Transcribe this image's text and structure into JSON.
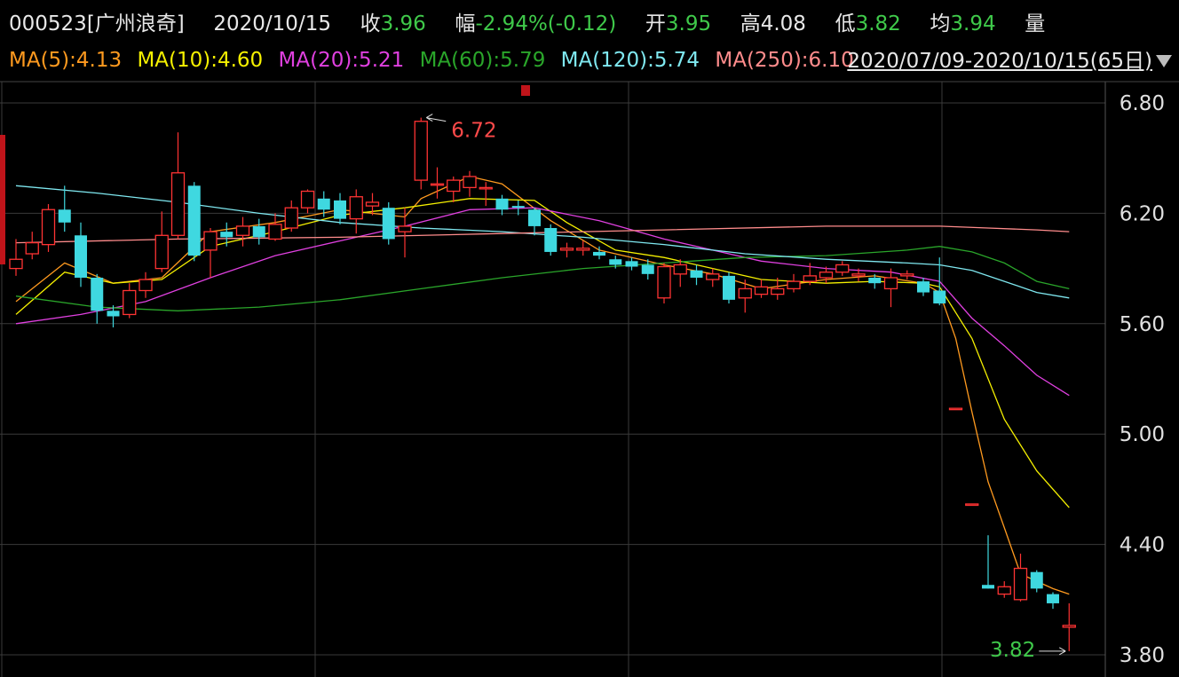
{
  "header": {
    "code": "000523",
    "name": "[广州浪奇]",
    "date": "2020/10/15",
    "close_label": "收",
    "close_value": "3.96",
    "change_label": "幅",
    "change_value": "-2.94%(-0.12)",
    "open_label": "开",
    "open_value": "3.95",
    "high_label": "高",
    "high_value": "4.08",
    "low_label": "低",
    "low_value": "3.82",
    "avg_label": "均",
    "avg_value": "3.94",
    "volume_label": "量"
  },
  "ma_legend": [
    {
      "label": "MA(5):4.13",
      "color": "#ff9a1f"
    },
    {
      "label": "MA(10):4.60",
      "color": "#f5f000"
    },
    {
      "label": "MA(20):5.21",
      "color": "#e040e0"
    },
    {
      "label": "MA(60):5.79",
      "color": "#2aa52a"
    },
    {
      "label": "MA(120):5.74",
      "color": "#7fe8f0"
    },
    {
      "label": "MA(250):6.10",
      "color": "#ff8c8c"
    }
  ],
  "range_label": "2020/07/09-2020/10/15(65日)",
  "dropdown_icon": "triangle-down-icon",
  "chart_data": {
    "type": "candlestick",
    "ylim": [
      3.8,
      6.8
    ],
    "yticks": [
      "6.80",
      "6.20",
      "5.60",
      "5.00",
      "4.40",
      "3.80"
    ],
    "annotations": [
      {
        "label": "6.72",
        "value": 6.72,
        "color": "#ff4a4a"
      },
      {
        "label": "3.82",
        "value": 3.82,
        "color": "#3fc94a"
      }
    ],
    "colors": {
      "up": "#ff3333",
      "down": "#3fd8e0",
      "grid": "#3a3a3a",
      "axis_text": "#e0e0e0"
    },
    "candles": [
      [
        5.9,
        5.95,
        6.06,
        5.86
      ],
      [
        5.98,
        6.04,
        6.1,
        5.95
      ],
      [
        6.03,
        6.22,
        6.25,
        5.99
      ],
      [
        6.22,
        6.15,
        6.35,
        6.1
      ],
      [
        6.08,
        5.85,
        6.15,
        5.8
      ],
      [
        5.85,
        5.67,
        5.87,
        5.6
      ],
      [
        5.67,
        5.64,
        5.7,
        5.58
      ],
      [
        5.65,
        5.78,
        5.82,
        5.63
      ],
      [
        5.78,
        5.84,
        5.88,
        5.74
      ],
      [
        5.9,
        6.08,
        6.21,
        5.88
      ],
      [
        6.08,
        6.42,
        6.64,
        6.06
      ],
      [
        6.35,
        5.97,
        6.37,
        5.94
      ],
      [
        6.0,
        6.1,
        6.12,
        5.85
      ],
      [
        6.1,
        6.07,
        6.15,
        6.02
      ],
      [
        6.08,
        6.13,
        6.18,
        6.02
      ],
      [
        6.13,
        6.07,
        6.17,
        6.03
      ],
      [
        6.06,
        6.14,
        6.2,
        6.05
      ],
      [
        6.12,
        6.23,
        6.27,
        6.1
      ],
      [
        6.23,
        6.32,
        6.33,
        6.2
      ],
      [
        6.28,
        6.22,
        6.32,
        6.18
      ],
      [
        6.27,
        6.17,
        6.31,
        6.14
      ],
      [
        6.17,
        6.29,
        6.33,
        6.09
      ],
      [
        6.24,
        6.26,
        6.31,
        6.19
      ],
      [
        6.23,
        6.06,
        6.26,
        6.03
      ],
      [
        6.1,
        6.13,
        6.23,
        5.96
      ],
      [
        6.38,
        6.7,
        6.72,
        6.33
      ],
      [
        6.36,
        6.36,
        6.45,
        6.28
      ],
      [
        6.32,
        6.38,
        6.4,
        6.26
      ],
      [
        6.34,
        6.4,
        6.43,
        6.29
      ],
      [
        6.34,
        6.34,
        6.37,
        6.24
      ],
      [
        6.28,
        6.22,
        6.3,
        6.19
      ],
      [
        6.24,
        6.23,
        6.27,
        6.19
      ],
      [
        6.22,
        6.13,
        6.23,
        6.08
      ],
      [
        6.12,
        5.99,
        6.14,
        5.97
      ],
      [
        6.0,
        6.01,
        6.04,
        5.96
      ],
      [
        6.0,
        6.01,
        6.05,
        5.97
      ],
      [
        5.99,
        5.97,
        6.02,
        5.95
      ],
      [
        5.95,
        5.92,
        5.97,
        5.9
      ],
      [
        5.94,
        5.91,
        5.96,
        5.89
      ],
      [
        5.92,
        5.87,
        5.95,
        5.84
      ],
      [
        5.74,
        5.91,
        5.93,
        5.71
      ],
      [
        5.87,
        5.92,
        5.95,
        5.8
      ],
      [
        5.89,
        5.85,
        5.92,
        5.81
      ],
      [
        5.84,
        5.87,
        5.9,
        5.8
      ],
      [
        5.86,
        5.73,
        5.88,
        5.71
      ],
      [
        5.74,
        5.79,
        5.84,
        5.66
      ],
      [
        5.76,
        5.8,
        5.84,
        5.74
      ],
      [
        5.76,
        5.79,
        5.85,
        5.73
      ],
      [
        5.79,
        5.83,
        5.87,
        5.77
      ],
      [
        5.83,
        5.86,
        5.93,
        5.81
      ],
      [
        5.85,
        5.88,
        5.91,
        5.82
      ],
      [
        5.88,
        5.92,
        5.94,
        5.86
      ],
      [
        5.86,
        5.87,
        5.9,
        5.83
      ],
      [
        5.85,
        5.82,
        5.87,
        5.79
      ],
      [
        5.79,
        5.85,
        5.9,
        5.69
      ],
      [
        5.86,
        5.87,
        5.89,
        5.84
      ],
      [
        5.83,
        5.77,
        5.85,
        5.75
      ],
      [
        5.78,
        5.71,
        5.96,
        5.7
      ],
      [
        5.14,
        5.14,
        5.14,
        5.14
      ],
      [
        4.62,
        4.62,
        4.62,
        4.62
      ],
      [
        4.18,
        4.16,
        4.45,
        4.16
      ],
      [
        4.13,
        4.17,
        4.2,
        4.11
      ],
      [
        4.1,
        4.27,
        4.35,
        4.09
      ],
      [
        4.25,
        4.16,
        4.26,
        4.14
      ],
      [
        4.13,
        4.08,
        4.14,
        4.05
      ],
      [
        3.95,
        3.96,
        4.08,
        3.82
      ]
    ],
    "series": [
      {
        "name": "MA(5)",
        "color": "#ff9a1f",
        "points": [
          [
            0,
            5.72
          ],
          [
            3,
            5.93
          ],
          [
            6,
            5.82
          ],
          [
            9,
            5.85
          ],
          [
            12,
            6.1
          ],
          [
            16,
            6.15
          ],
          [
            20,
            6.22
          ],
          [
            24,
            6.18
          ],
          [
            25,
            6.28
          ],
          [
            28,
            6.4
          ],
          [
            30,
            6.36
          ],
          [
            33,
            6.16
          ],
          [
            36,
            6.0
          ],
          [
            40,
            5.92
          ],
          [
            43,
            5.87
          ],
          [
            46,
            5.79
          ],
          [
            50,
            5.84
          ],
          [
            53,
            5.86
          ],
          [
            56,
            5.82
          ],
          [
            57,
            5.77
          ],
          [
            58,
            5.52
          ],
          [
            59,
            5.12
          ],
          [
            60,
            4.74
          ],
          [
            61,
            4.49
          ],
          [
            62,
            4.24
          ],
          [
            63,
            4.2
          ],
          [
            64,
            4.16
          ],
          [
            65,
            4.13
          ]
        ]
      },
      {
        "name": "MA(10)",
        "color": "#f5f000",
        "points": [
          [
            0,
            5.65
          ],
          [
            3,
            5.88
          ],
          [
            6,
            5.82
          ],
          [
            9,
            5.84
          ],
          [
            12,
            6.02
          ],
          [
            16,
            6.1
          ],
          [
            20,
            6.19
          ],
          [
            24,
            6.23
          ],
          [
            28,
            6.28
          ],
          [
            32,
            6.27
          ],
          [
            34,
            6.15
          ],
          [
            37,
            6.0
          ],
          [
            40,
            5.96
          ],
          [
            43,
            5.9
          ],
          [
            46,
            5.84
          ],
          [
            50,
            5.82
          ],
          [
            53,
            5.83
          ],
          [
            56,
            5.82
          ],
          [
            57,
            5.8
          ],
          [
            59,
            5.52
          ],
          [
            61,
            5.08
          ],
          [
            63,
            4.8
          ],
          [
            65,
            4.6
          ]
        ]
      },
      {
        "name": "MA(20)",
        "color": "#e040e0",
        "points": [
          [
            0,
            5.6
          ],
          [
            4,
            5.65
          ],
          [
            8,
            5.72
          ],
          [
            12,
            5.85
          ],
          [
            16,
            5.97
          ],
          [
            20,
            6.05
          ],
          [
            24,
            6.13
          ],
          [
            28,
            6.22
          ],
          [
            32,
            6.23
          ],
          [
            36,
            6.16
          ],
          [
            40,
            6.06
          ],
          [
            43,
            6.0
          ],
          [
            46,
            5.94
          ],
          [
            50,
            5.9
          ],
          [
            54,
            5.88
          ],
          [
            57,
            5.83
          ],
          [
            59,
            5.63
          ],
          [
            61,
            5.48
          ],
          [
            63,
            5.32
          ],
          [
            65,
            5.21
          ]
        ]
      },
      {
        "name": "MA(60)",
        "color": "#2aa52a",
        "points": [
          [
            0,
            5.75
          ],
          [
            5,
            5.69
          ],
          [
            10,
            5.67
          ],
          [
            15,
            5.69
          ],
          [
            20,
            5.73
          ],
          [
            25,
            5.79
          ],
          [
            30,
            5.85
          ],
          [
            35,
            5.9
          ],
          [
            40,
            5.93
          ],
          [
            45,
            5.96
          ],
          [
            50,
            5.97
          ],
          [
            55,
            6.0
          ],
          [
            57,
            6.02
          ],
          [
            59,
            5.99
          ],
          [
            61,
            5.93
          ],
          [
            63,
            5.83
          ],
          [
            65,
            5.79
          ]
        ]
      },
      {
        "name": "MA(120)",
        "color": "#7fe8f0",
        "points": [
          [
            0,
            6.35
          ],
          [
            5,
            6.31
          ],
          [
            10,
            6.26
          ],
          [
            15,
            6.2
          ],
          [
            20,
            6.15
          ],
          [
            25,
            6.12
          ],
          [
            30,
            6.1
          ],
          [
            35,
            6.07
          ],
          [
            40,
            6.03
          ],
          [
            45,
            5.98
          ],
          [
            50,
            5.95
          ],
          [
            55,
            5.93
          ],
          [
            57,
            5.92
          ],
          [
            59,
            5.89
          ],
          [
            61,
            5.83
          ],
          [
            63,
            5.77
          ],
          [
            65,
            5.74
          ]
        ]
      },
      {
        "name": "MA(250)",
        "color": "#ff8c8c",
        "points": [
          [
            0,
            6.04
          ],
          [
            10,
            6.06
          ],
          [
            20,
            6.07
          ],
          [
            30,
            6.09
          ],
          [
            40,
            6.11
          ],
          [
            50,
            6.13
          ],
          [
            57,
            6.13
          ],
          [
            60,
            6.12
          ],
          [
            63,
            6.11
          ],
          [
            65,
            6.1
          ]
        ]
      }
    ]
  }
}
